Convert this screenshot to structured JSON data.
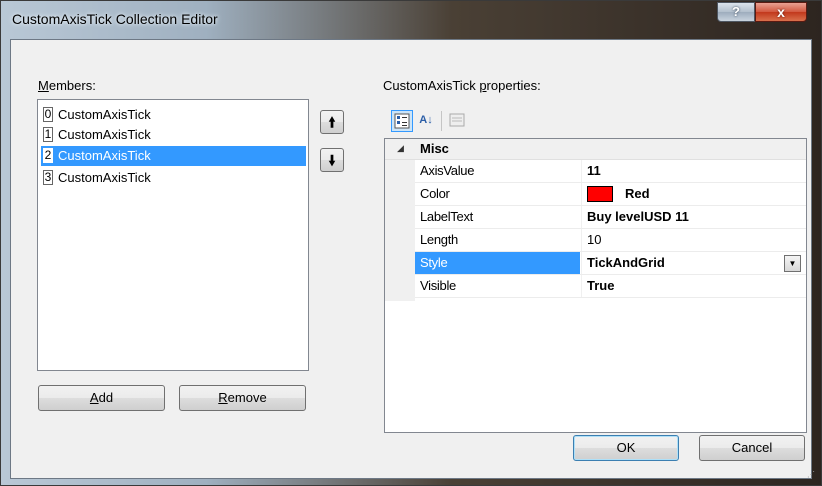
{
  "window": {
    "title": "CustomAxisTick Collection Editor",
    "help_glyph": "?",
    "close_glyph": "x"
  },
  "members": {
    "label_pre": "",
    "label_ul": "M",
    "label_post": "embers:",
    "items": [
      {
        "index": "0",
        "text": "CustomAxisTick"
      },
      {
        "index": "1",
        "text": "CustomAxisTick"
      },
      {
        "index": "2",
        "text": "CustomAxisTick",
        "selected": true
      },
      {
        "index": "3",
        "text": "CustomAxisTick"
      }
    ],
    "move_up_glyph": "🠙",
    "move_down_glyph": "🠛",
    "add": {
      "ul": "A",
      "rest": "dd"
    },
    "remove": {
      "ul": "R",
      "rest": "emove"
    }
  },
  "properties": {
    "label_pre": "CustomAxisTick ",
    "label_ul": "p",
    "label_post": "roperties:",
    "toolbar": {
      "categorized_icon": "categorized-icon",
      "alphabetical_glyph": "A↓",
      "property_pages_icon": "property-pages-icon"
    },
    "category": {
      "glyph": "◢",
      "name": "Misc"
    },
    "rows": [
      {
        "name": "AxisValue",
        "value": "11",
        "bold": true
      },
      {
        "name": "Color",
        "value": "Red",
        "bold": true,
        "swatch": "#ff0000"
      },
      {
        "name": "LabelText",
        "value": "Buy levelUSD 11",
        "bold": true
      },
      {
        "name": "Length",
        "value": "10",
        "bold": false
      },
      {
        "name": "Style",
        "value": "TickAndGrid",
        "bold": true,
        "selected": true,
        "dropdown_glyph": "▼"
      },
      {
        "name": "Visible",
        "value": "True",
        "bold": true
      }
    ]
  },
  "buttons": {
    "ok": "OK",
    "cancel": "Cancel"
  },
  "grip_glyph": "⋰"
}
